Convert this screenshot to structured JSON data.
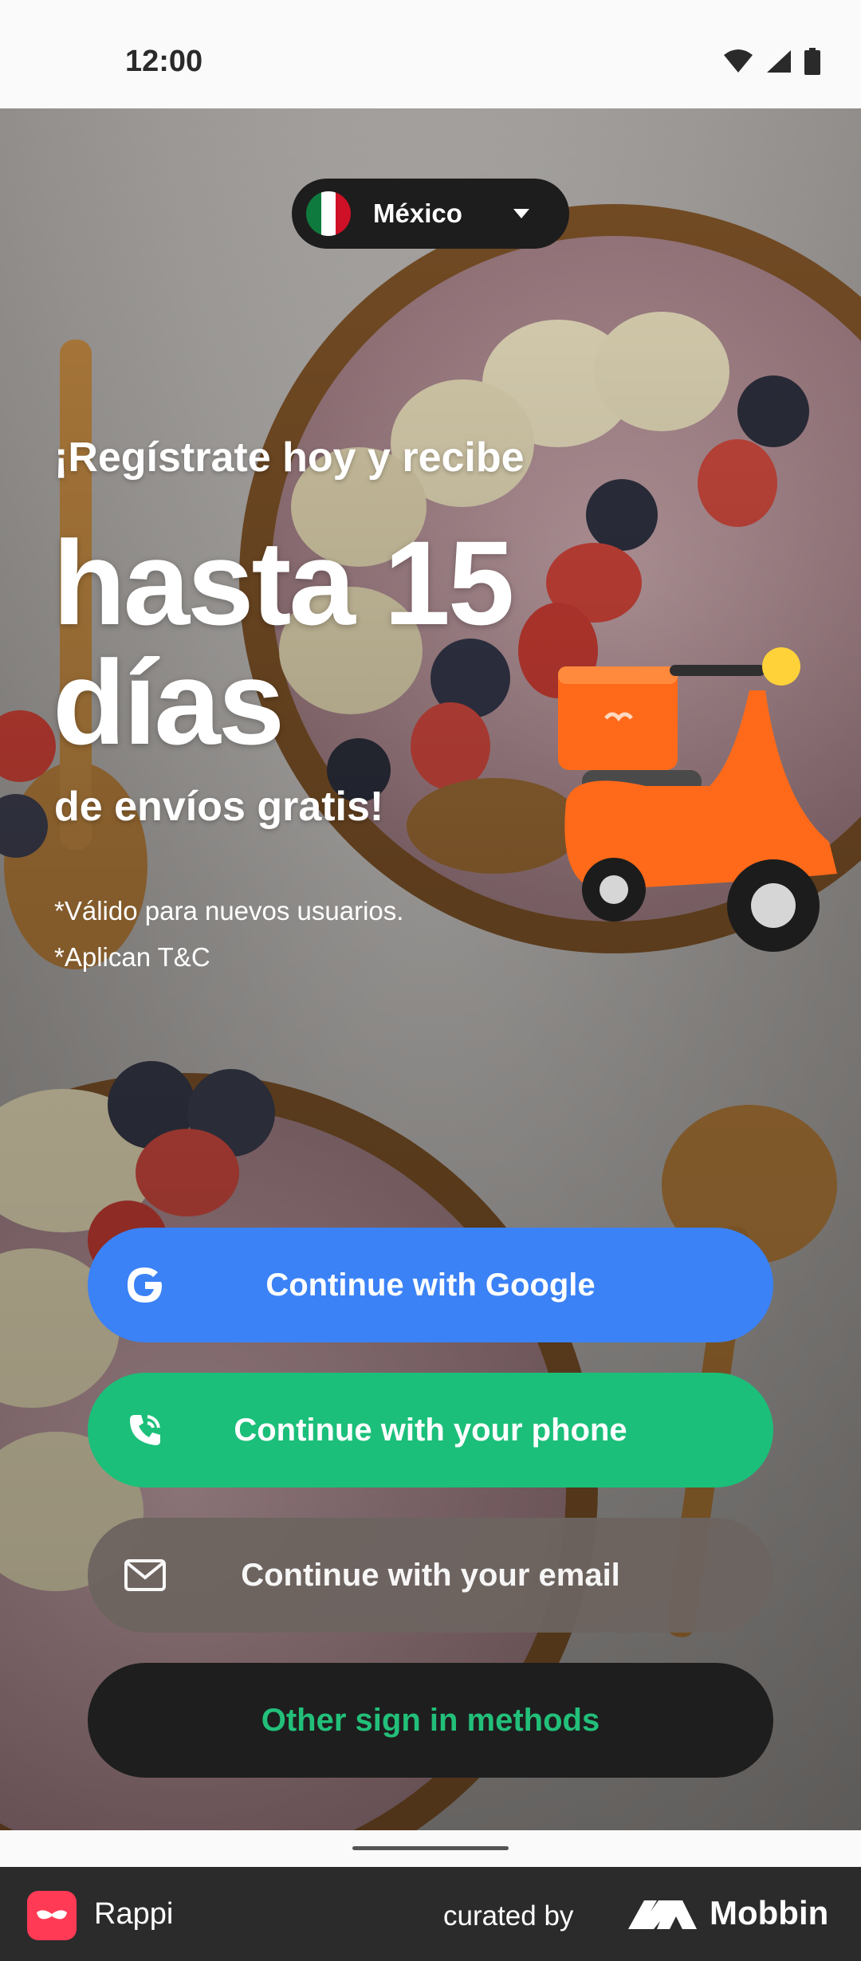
{
  "status_bar": {
    "time": "12:00"
  },
  "country_selector": {
    "label": "México"
  },
  "promo": {
    "line1": "¡Regístrate hoy y recibe",
    "big": "hasta 15 días",
    "line3": "de envíos gratis!",
    "disclaimer1": "*Válido para nuevos usuarios.",
    "disclaimer2": "*Aplican T&C"
  },
  "buttons": {
    "google": "Continue with Google",
    "phone": "Continue with your phone",
    "email": "Continue with your email",
    "other": "Other sign in methods"
  },
  "footer": {
    "app_name": "Rappi",
    "curated_by": "curated by",
    "brand": "Mobbin"
  },
  "colors": {
    "google_button": "#3b82f6",
    "phone_button": "#1bbf7a",
    "email_button": "#6d6460",
    "other_button": "#1e1e1e",
    "other_text": "#22c07a",
    "rappi_brand": "#ff3a55",
    "scooter": "#ff6a1a"
  },
  "icons": [
    "wifi-icon",
    "signal-icon",
    "battery-icon",
    "mexico-flag-icon",
    "chevron-down-icon",
    "google-icon",
    "phone-icon",
    "mail-icon",
    "rappi-logo-icon",
    "mobbin-logo-icon"
  ]
}
